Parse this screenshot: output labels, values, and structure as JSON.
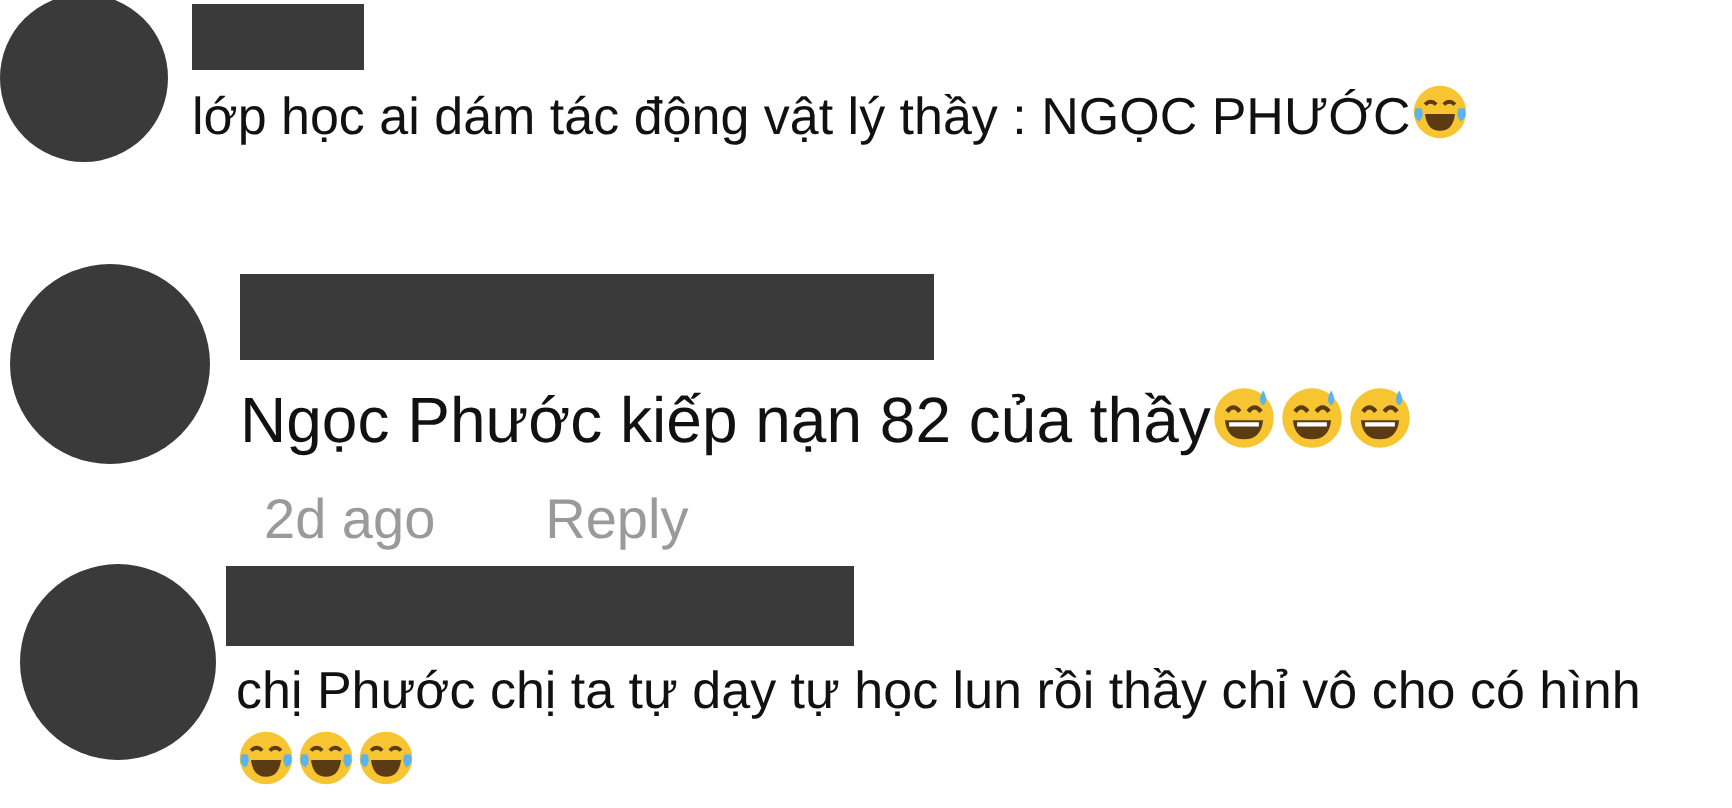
{
  "comments": [
    {
      "text": "lớp học ai dám tác động vật lý thầy : NGỌC PHƯỚC",
      "emojis": [
        {
          "kind": "laugh"
        }
      ]
    },
    {
      "text": "Ngọc Phước kiếp nạn 82 của thầy",
      "emojis": [
        {
          "kind": "sweat"
        },
        {
          "kind": "sweat"
        },
        {
          "kind": "sweat"
        }
      ],
      "time": "2d ago",
      "reply": "Reply"
    },
    {
      "text": "chị Phước chị ta tự dạy tự học lun rồi thầy chỉ vô cho có hình",
      "emojis": [
        {
          "kind": "laugh"
        },
        {
          "kind": "laugh"
        },
        {
          "kind": "laugh"
        }
      ]
    }
  ]
}
